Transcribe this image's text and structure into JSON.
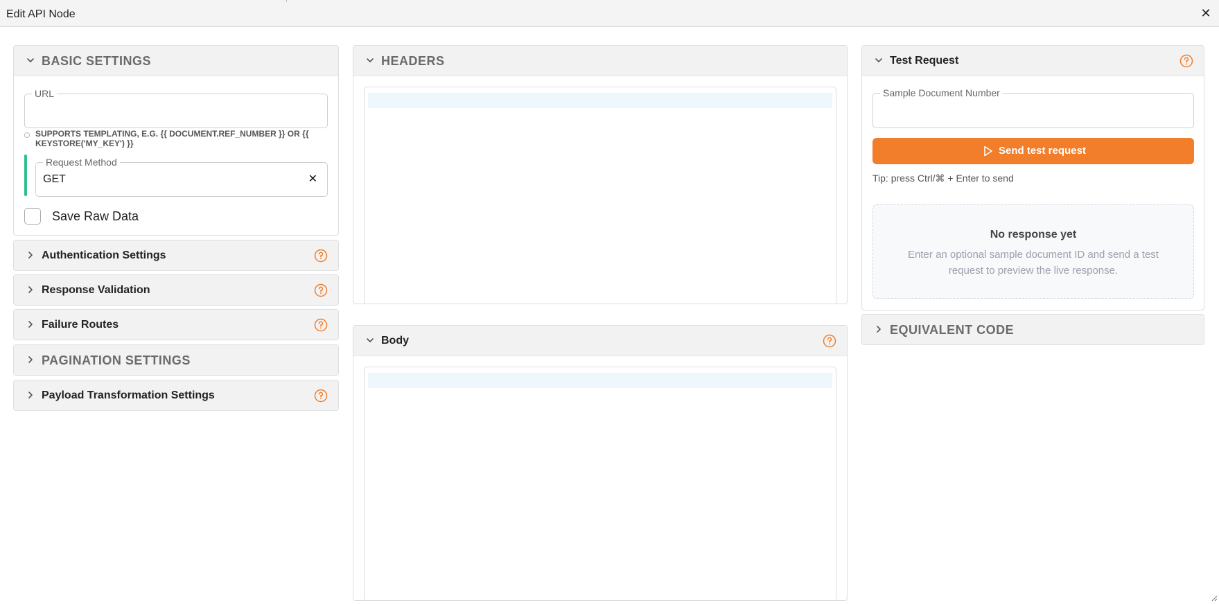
{
  "dialog": {
    "title": "Edit API Node",
    "close_symbol": "✕"
  },
  "colors": {
    "accent": "#f27d2a",
    "method_indicator": "#2fbf8f",
    "editor_highlight": "#eef7fb"
  },
  "basic_settings": {
    "title": "BASIC SETTINGS",
    "url_label": "URL",
    "url_value": "",
    "url_hint": "SUPPORTS TEMPLATING, E.G. {{ DOCUMENT.REF_NUMBER }} OR {{ KEYSTORE('MY_KEY') }}",
    "method_label": "Request Method",
    "method_value": "GET",
    "clear_symbol": "✕",
    "save_raw_label": "Save Raw Data",
    "save_raw_checked": false
  },
  "left_sections": [
    {
      "title": "Authentication Settings",
      "help": true
    },
    {
      "title": "Response Validation",
      "help": true
    },
    {
      "title": "Failure Routes",
      "help": true
    },
    {
      "title": "PAGINATION SETTINGS",
      "help": false
    },
    {
      "title": "Payload Transformation Settings",
      "help": true
    }
  ],
  "headers": {
    "title": "HEADERS"
  },
  "body": {
    "title": "Body"
  },
  "test_request": {
    "title": "Test Request",
    "sample_label": "Sample Document Number",
    "sample_value": "",
    "send_label": "Send test request",
    "tip": "Tip: press Ctrl/⌘ + Enter to send",
    "empty_title": "No response yet",
    "empty_desc": "Enter an optional sample document ID and send a test request to preview the live response."
  },
  "equivalent_code": {
    "title": "EQUIVALENT CODE"
  },
  "icons": {
    "close": "close-icon",
    "chevron_down": "chevron-down-icon",
    "chevron_right": "chevron-right-icon",
    "help": "help-icon",
    "play": "play-icon",
    "info": "info-icon",
    "resize": "resize-grip-icon"
  }
}
